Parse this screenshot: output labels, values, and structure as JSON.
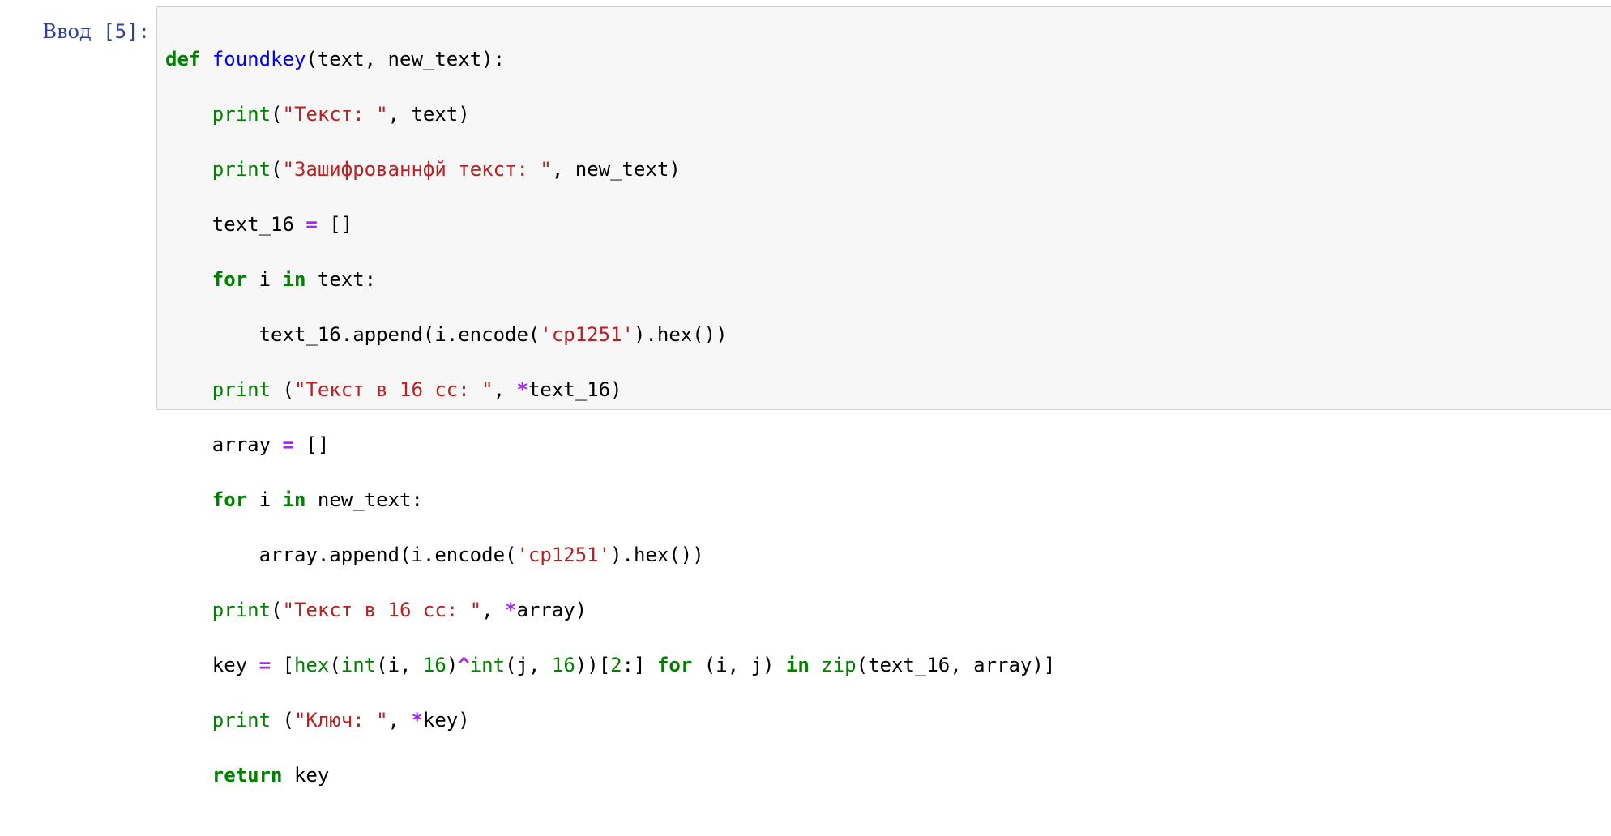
{
  "cell": {
    "prompt_label": "Ввод",
    "prompt_number": " [5]:",
    "execution_count": 5
  },
  "code": {
    "language": "python",
    "line1": {
      "kw_def": "def",
      "fn_name": "foundkey",
      "params": "(text, new_text):"
    },
    "line2": {
      "indent": "    ",
      "bi": "print",
      "p1": "(",
      "str": "\"Текст: \"",
      "p2": ", text)"
    },
    "line3": {
      "indent": "    ",
      "bi": "print",
      "p1": "(",
      "str": "\"Зашифрованнфй текст: \"",
      "p2": ", new_text)"
    },
    "line4": {
      "indent": "    ",
      "t1": "text_16 ",
      "op": "=",
      "t2": " []"
    },
    "line5": {
      "indent": "    ",
      "kw_for": "for",
      "t1": " i ",
      "kw_in": "in",
      "t2": " text:"
    },
    "line6": {
      "indent": "        ",
      "t1": "text_16.append(i.encode(",
      "str": "'cp1251'",
      "t2": ").hex())"
    },
    "line7": {
      "indent": "    ",
      "bi": "print",
      "p1": " (",
      "str": "\"Текст в 16 сс: \"",
      "p2": ", ",
      "op": "*",
      "p3": "text_16)"
    },
    "line8": {
      "indent": "    ",
      "t1": "array ",
      "op": "=",
      "t2": " []"
    },
    "line9": {
      "indent": "    ",
      "kw_for": "for",
      "t1": " i ",
      "kw_in": "in",
      "t2": " new_text:"
    },
    "line10": {
      "indent": "        ",
      "t1": "array.append(i.encode(",
      "str": "'cp1251'",
      "t2": ").hex())"
    },
    "line11": {
      "indent": "    ",
      "bi": "print",
      "p1": "(",
      "str": "\"Текст в 16 сс: \"",
      "p2": ", ",
      "op": "*",
      "p3": "array)"
    },
    "line12": {
      "indent": "    ",
      "t1": "key ",
      "op_eq": "=",
      "t2": " [",
      "bi_hex": "hex",
      "t3": "(",
      "bi_int1": "int",
      "t4": "(i, ",
      "n1": "16",
      "t5": ")",
      "op_xor": "^",
      "bi_int2": "int",
      "t6": "(j, ",
      "n2": "16",
      "t7": "))[",
      "n3": "2",
      "t8": ":] ",
      "kw_for": "for",
      "t9": " (i, j) ",
      "kw_in": "in",
      "t10": " ",
      "bi_zip": "zip",
      "t11": "(text_16, array)]"
    },
    "line13": {
      "indent": "    ",
      "bi": "print",
      "p1": " (",
      "str": "\"Ключ: \"",
      "p2": ", ",
      "op": "*",
      "p3": "key)"
    },
    "line14": {
      "indent": "    ",
      "kw_return": "return",
      "t1": " key"
    }
  },
  "colors": {
    "prompt": "#303f9f",
    "keyword": "#008000",
    "function_name": "#0000ff",
    "string": "#ba2121",
    "operator": "#aa22ff",
    "cell_background": "#f7f7f7",
    "cell_border": "#cfcfcf"
  }
}
